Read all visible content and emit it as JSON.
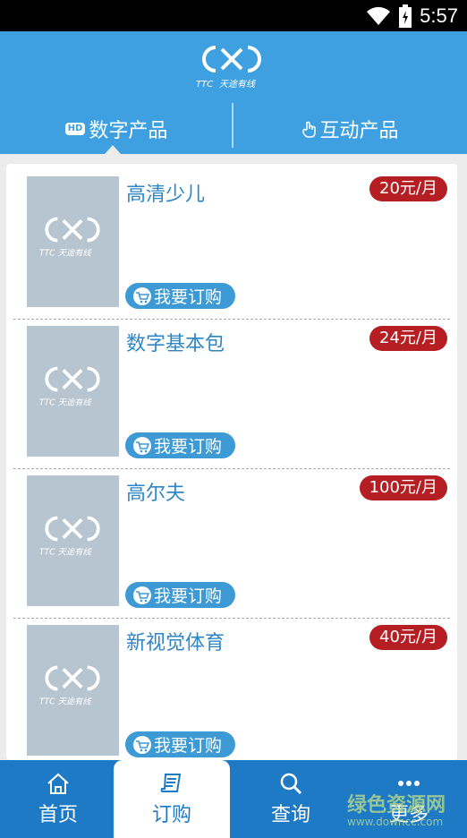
{
  "status": {
    "time": "5:57"
  },
  "header": {
    "logo_text": "天途有线"
  },
  "tabs": [
    {
      "badge": "HD",
      "label": "数字产品"
    },
    {
      "label": "互动产品"
    }
  ],
  "products": [
    {
      "name": "高清少儿",
      "price": "20元/月",
      "button": "我要订购"
    },
    {
      "name": "数字基本包",
      "price": "24元/月",
      "button": "我要订购"
    },
    {
      "name": "高尔夫",
      "price": "100元/月",
      "button": "我要订购"
    },
    {
      "name": "新视觉体育",
      "price": "40元/月",
      "button": "我要订购"
    }
  ],
  "nav": {
    "home": "首页",
    "order": "订购",
    "query": "查询",
    "more": "更多"
  },
  "watermark": {
    "main": "绿色资源网",
    "sub": "www.downcc.com"
  },
  "colors": {
    "header": "#3ea0e0",
    "nav": "#1f7ac6",
    "price": "#b51e23",
    "title": "#2e86c5"
  }
}
